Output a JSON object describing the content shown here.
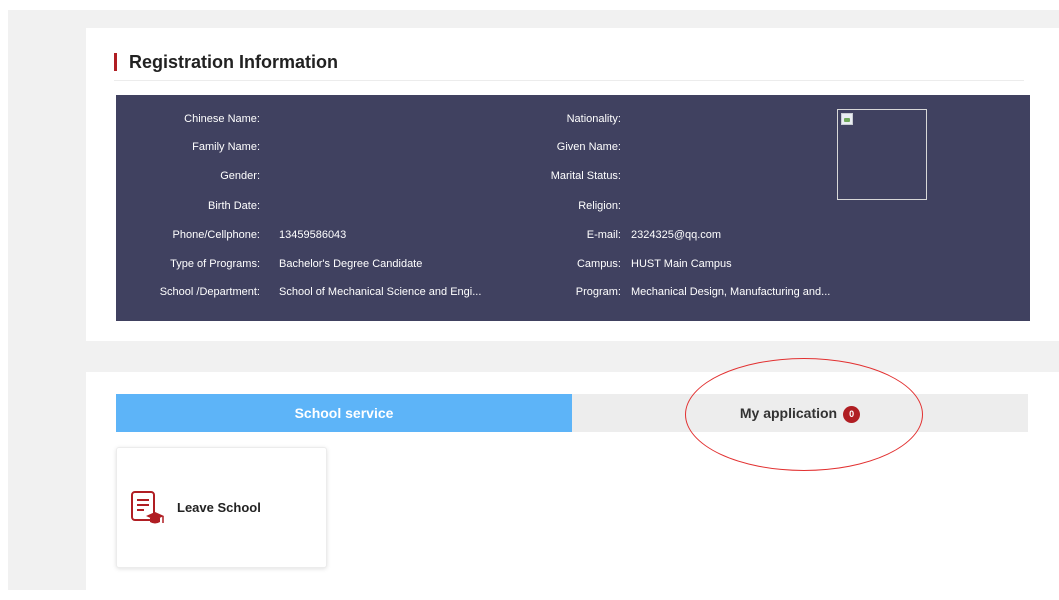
{
  "registration": {
    "title": "Registration Information",
    "fields_left": [
      {
        "label": "Chinese Name:",
        "value": ""
      },
      {
        "label": "Family Name:",
        "value": ""
      },
      {
        "label": "Gender:",
        "value": ""
      },
      {
        "label": "Birth Date:",
        "value": ""
      },
      {
        "label": "Phone/Cellphone:",
        "value": "13459586043"
      },
      {
        "label": "Type of Programs:",
        "value": "Bachelor's Degree Candidate"
      },
      {
        "label": "School /Department:",
        "value": "School of Mechanical Science and Engi..."
      }
    ],
    "fields_right": [
      {
        "label": "Nationality:",
        "value": ""
      },
      {
        "label": "Given Name:",
        "value": ""
      },
      {
        "label": "Marital Status:",
        "value": ""
      },
      {
        "label": "Religion:",
        "value": ""
      },
      {
        "label": "E-mail:",
        "value": "2324325@qq.com"
      },
      {
        "label": "Campus:",
        "value": "HUST Main Campus"
      },
      {
        "label": "Program:",
        "value": "Mechanical Design, Manufacturing and..."
      }
    ],
    "photo_icon": "broken-image-icon"
  },
  "tabs": {
    "school_service": "School service",
    "my_application": "My application",
    "my_application_count": "0"
  },
  "services": [
    {
      "label": "Leave School",
      "icon": "leave-school-document-icon"
    }
  ],
  "colors": {
    "accent_red": "#b01e23",
    "panel_bg": "#404160",
    "tab_active": "#5db4f8",
    "tab_inactive": "#ededed",
    "annotation": "#e23131"
  }
}
